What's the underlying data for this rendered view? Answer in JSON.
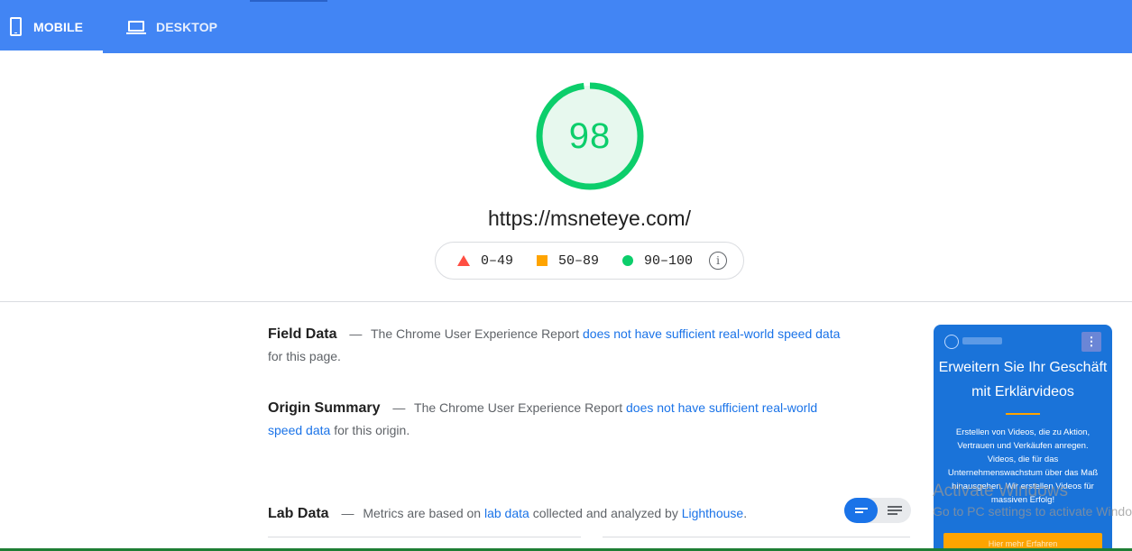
{
  "tabs": [
    {
      "label": "MOBILE",
      "icon": "mobile-phone-icon",
      "active": true
    },
    {
      "label": "DESKTOP",
      "icon": "laptop-icon",
      "active": false
    }
  ],
  "colors": {
    "brand_blue": "#4285f4",
    "pass": "#0cce6b",
    "average": "#ffa400",
    "fail": "#ff4e42",
    "link": "#1a73e8"
  },
  "score": {
    "value": "98",
    "fraction": 0.98
  },
  "url": "https://msneteye.com/",
  "legend": [
    {
      "range": "0–49",
      "icon": "triangle-red"
    },
    {
      "range": "50–89",
      "icon": "square-orange"
    },
    {
      "range": "90–100",
      "icon": "circle-green"
    }
  ],
  "field_data": {
    "title": "Field Data",
    "dash": "—",
    "text_before": "The Chrome User Experience Report",
    "link": "does not have sufficient real-world speed data",
    "text_after": "for this page."
  },
  "origin_summary": {
    "title": "Origin Summary",
    "dash": "—",
    "text_before": "The Chrome User Experience Report",
    "link": "does not have sufficient real-world speed data",
    "text_after": "for this origin."
  },
  "lab_data": {
    "title": "Lab Data",
    "dash": "—",
    "text_before": "Metrics are based on",
    "link1": "lab data",
    "text_middle": "collected and analyzed by",
    "link2": "Lighthouse",
    "text_after": "."
  },
  "thumbnail": {
    "menu_glyph": "⋮",
    "title": "Erweitern Sie Ihr Geschäft mit Erklärvideos",
    "body": "Erstellen von Videos, die zu Aktion, Vertrauen und Verkäufen anregen. Videos, die für das Unternehmenswachstum über das Maß hinausgehen. Wir erstellen Videos für massiven Erfolg!",
    "button": "Hier mehr Erfahren"
  },
  "watermark": {
    "line1": "Activate Windows",
    "line2": "Go to PC settings to activate Windows."
  }
}
